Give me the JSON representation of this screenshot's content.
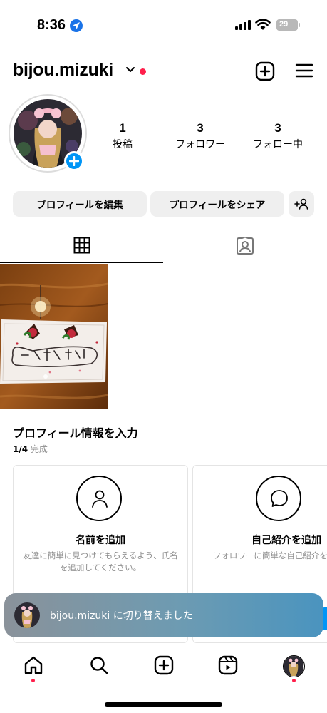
{
  "status_bar": {
    "time": "8:36",
    "battery": "29"
  },
  "header": {
    "username": "bijou.mizuki",
    "icons": [
      "chevron-down-icon",
      "new-post-icon",
      "menu-icon"
    ]
  },
  "profile": {
    "stats": [
      {
        "count": "1",
        "label": "投稿"
      },
      {
        "count": "3",
        "label": "フォロワー"
      },
      {
        "count": "3",
        "label": "フォロー中"
      }
    ]
  },
  "actions": {
    "edit_profile": "プロフィールを編集",
    "share_profile": "プロフィールをシェア"
  },
  "tabs": [
    "grid-icon",
    "tagged-icon"
  ],
  "completion": {
    "title": "プロフィール情報を入力",
    "progress": "1/4",
    "progress_label": "完成",
    "cards": [
      {
        "title": "名前を追加",
        "description": "友達に簡単に見つけてもらえるよう、氏名を追加してください。"
      },
      {
        "title": "自己紹介を追加",
        "description": "フォロワーに簡単な自己紹介をしよう。"
      }
    ]
  },
  "toast": {
    "username": "bijou.mizuki",
    "message": "に切り替えました"
  },
  "bottom_nav": [
    "home-icon",
    "search-icon",
    "create-icon",
    "reels-icon",
    "profile-avatar"
  ],
  "colors": {
    "accent_blue": "#0095f6",
    "notification_red": "#ff1f4b",
    "button_gray": "#efefef"
  }
}
